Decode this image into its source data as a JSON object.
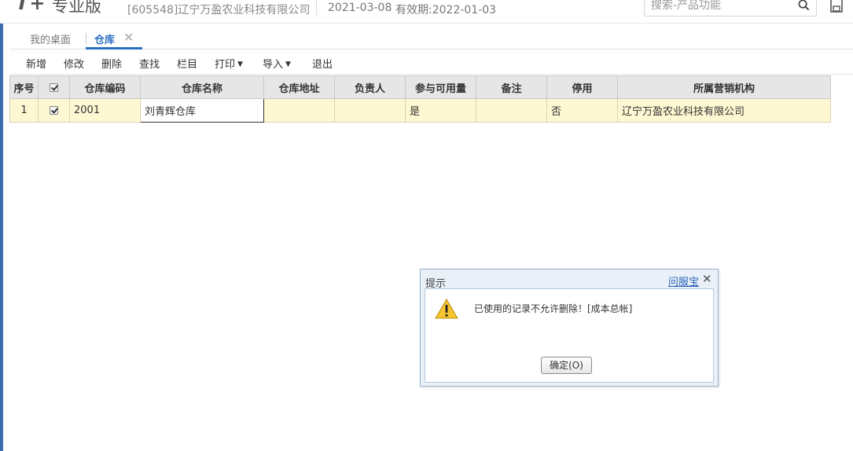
{
  "header": {
    "logo": "T+",
    "edition": "专业版",
    "company": "[605548]辽宁万盈农业科技有限公司",
    "login_date": "2021-03-08",
    "validity": "有效期:2022-01-03",
    "search_placeholder": "搜索-产品功能",
    "search_icon": "search-icon",
    "save_icon": "save-icon"
  },
  "tabs": [
    {
      "label": "我的桌面",
      "active": false
    },
    {
      "label": "仓库",
      "active": true,
      "closable": true
    }
  ],
  "tab_close_glyph": "✕",
  "toolbar": {
    "items": [
      {
        "label": "新增"
      },
      {
        "label": "修改"
      },
      {
        "label": "删除"
      },
      {
        "label": "查找"
      },
      {
        "label": "栏目"
      },
      {
        "label": "打印",
        "dropdown": true
      },
      {
        "label": "导入",
        "dropdown": true
      },
      {
        "label": "退出"
      }
    ]
  },
  "grid": {
    "columns": [
      "序号",
      "",
      "仓库编码",
      "仓库名称",
      "仓库地址",
      "负责人",
      "参与可用量",
      "备注",
      "停用",
      "所属营销机构"
    ],
    "rows": [
      {
        "seq": "1",
        "checked": true,
        "code": "2001",
        "name": "刘青辉仓库",
        "address": "",
        "manager": "",
        "available": "是",
        "remark": "",
        "disabled": "否",
        "org": "辽宁万盈农业科技有限公司"
      }
    ]
  },
  "dialog": {
    "title": "提示",
    "help_link": "问服宝",
    "close_glyph": "✕",
    "message": "已使用的记录不允许删除！[成本总帐]",
    "ok_label": "确定(O)",
    "icon": "warning-icon"
  },
  "colors": {
    "accent": "#2b6fc2",
    "row_highlight": "#fdf7d2",
    "header_bg": "#e6e6e6",
    "dialog_bg": "#e9f0f8"
  }
}
